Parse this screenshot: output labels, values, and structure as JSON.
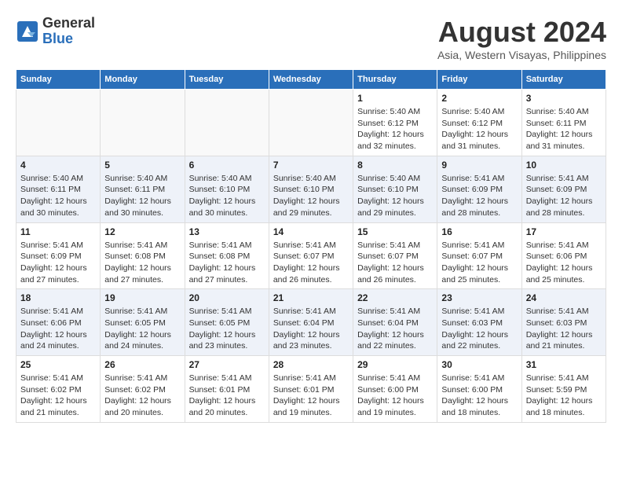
{
  "header": {
    "logo": {
      "general": "General",
      "blue": "Blue"
    },
    "title": "August 2024",
    "subtitle": "Asia, Western Visayas, Philippines"
  },
  "days": [
    "Sunday",
    "Monday",
    "Tuesday",
    "Wednesday",
    "Thursday",
    "Friday",
    "Saturday"
  ],
  "weeks": [
    [
      {
        "day": "",
        "text": ""
      },
      {
        "day": "",
        "text": ""
      },
      {
        "day": "",
        "text": ""
      },
      {
        "day": "",
        "text": ""
      },
      {
        "day": "1",
        "text": "Sunrise: 5:40 AM\nSunset: 6:12 PM\nDaylight: 12 hours\nand 32 minutes."
      },
      {
        "day": "2",
        "text": "Sunrise: 5:40 AM\nSunset: 6:12 PM\nDaylight: 12 hours\nand 31 minutes."
      },
      {
        "day": "3",
        "text": "Sunrise: 5:40 AM\nSunset: 6:11 PM\nDaylight: 12 hours\nand 31 minutes."
      }
    ],
    [
      {
        "day": "4",
        "text": "Sunrise: 5:40 AM\nSunset: 6:11 PM\nDaylight: 12 hours\nand 30 minutes."
      },
      {
        "day": "5",
        "text": "Sunrise: 5:40 AM\nSunset: 6:11 PM\nDaylight: 12 hours\nand 30 minutes."
      },
      {
        "day": "6",
        "text": "Sunrise: 5:40 AM\nSunset: 6:10 PM\nDaylight: 12 hours\nand 30 minutes."
      },
      {
        "day": "7",
        "text": "Sunrise: 5:40 AM\nSunset: 6:10 PM\nDaylight: 12 hours\nand 29 minutes."
      },
      {
        "day": "8",
        "text": "Sunrise: 5:40 AM\nSunset: 6:10 PM\nDaylight: 12 hours\nand 29 minutes."
      },
      {
        "day": "9",
        "text": "Sunrise: 5:41 AM\nSunset: 6:09 PM\nDaylight: 12 hours\nand 28 minutes."
      },
      {
        "day": "10",
        "text": "Sunrise: 5:41 AM\nSunset: 6:09 PM\nDaylight: 12 hours\nand 28 minutes."
      }
    ],
    [
      {
        "day": "11",
        "text": "Sunrise: 5:41 AM\nSunset: 6:09 PM\nDaylight: 12 hours\nand 27 minutes."
      },
      {
        "day": "12",
        "text": "Sunrise: 5:41 AM\nSunset: 6:08 PM\nDaylight: 12 hours\nand 27 minutes."
      },
      {
        "day": "13",
        "text": "Sunrise: 5:41 AM\nSunset: 6:08 PM\nDaylight: 12 hours\nand 27 minutes."
      },
      {
        "day": "14",
        "text": "Sunrise: 5:41 AM\nSunset: 6:07 PM\nDaylight: 12 hours\nand 26 minutes."
      },
      {
        "day": "15",
        "text": "Sunrise: 5:41 AM\nSunset: 6:07 PM\nDaylight: 12 hours\nand 26 minutes."
      },
      {
        "day": "16",
        "text": "Sunrise: 5:41 AM\nSunset: 6:07 PM\nDaylight: 12 hours\nand 25 minutes."
      },
      {
        "day": "17",
        "text": "Sunrise: 5:41 AM\nSunset: 6:06 PM\nDaylight: 12 hours\nand 25 minutes."
      }
    ],
    [
      {
        "day": "18",
        "text": "Sunrise: 5:41 AM\nSunset: 6:06 PM\nDaylight: 12 hours\nand 24 minutes."
      },
      {
        "day": "19",
        "text": "Sunrise: 5:41 AM\nSunset: 6:05 PM\nDaylight: 12 hours\nand 24 minutes."
      },
      {
        "day": "20",
        "text": "Sunrise: 5:41 AM\nSunset: 6:05 PM\nDaylight: 12 hours\nand 23 minutes."
      },
      {
        "day": "21",
        "text": "Sunrise: 5:41 AM\nSunset: 6:04 PM\nDaylight: 12 hours\nand 23 minutes."
      },
      {
        "day": "22",
        "text": "Sunrise: 5:41 AM\nSunset: 6:04 PM\nDaylight: 12 hours\nand 22 minutes."
      },
      {
        "day": "23",
        "text": "Sunrise: 5:41 AM\nSunset: 6:03 PM\nDaylight: 12 hours\nand 22 minutes."
      },
      {
        "day": "24",
        "text": "Sunrise: 5:41 AM\nSunset: 6:03 PM\nDaylight: 12 hours\nand 21 minutes."
      }
    ],
    [
      {
        "day": "25",
        "text": "Sunrise: 5:41 AM\nSunset: 6:02 PM\nDaylight: 12 hours\nand 21 minutes."
      },
      {
        "day": "26",
        "text": "Sunrise: 5:41 AM\nSunset: 6:02 PM\nDaylight: 12 hours\nand 20 minutes."
      },
      {
        "day": "27",
        "text": "Sunrise: 5:41 AM\nSunset: 6:01 PM\nDaylight: 12 hours\nand 20 minutes."
      },
      {
        "day": "28",
        "text": "Sunrise: 5:41 AM\nSunset: 6:01 PM\nDaylight: 12 hours\nand 19 minutes."
      },
      {
        "day": "29",
        "text": "Sunrise: 5:41 AM\nSunset: 6:00 PM\nDaylight: 12 hours\nand 19 minutes."
      },
      {
        "day": "30",
        "text": "Sunrise: 5:41 AM\nSunset: 6:00 PM\nDaylight: 12 hours\nand 18 minutes."
      },
      {
        "day": "31",
        "text": "Sunrise: 5:41 AM\nSunset: 5:59 PM\nDaylight: 12 hours\nand 18 minutes."
      }
    ]
  ]
}
